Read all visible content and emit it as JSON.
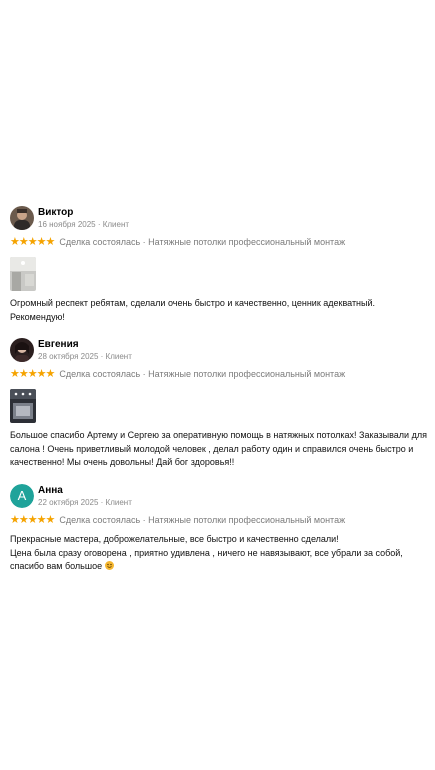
{
  "colors": {
    "star": "#f5a300",
    "meta_text": "#8a8a8a",
    "avatar_anna": "#1fa39a"
  },
  "reviews": [
    {
      "author": "Виктор",
      "meta": "16 ноября 2025 · Клиент",
      "rating": 5,
      "stars": [
        "★",
        "★",
        "★",
        "★",
        "★"
      ],
      "deal": "Сделка состоялась · Натяжные потолки профессиональный монтаж",
      "avatar_type": "photo",
      "has_photo": true,
      "text_lines": [
        "Огромный респект ребятам, сделали очень быстро и качественно, ценник адекватный.",
        "Рекомендую!"
      ]
    },
    {
      "author": "Евгения",
      "meta": "28 октября 2025 · Клиент",
      "rating": 5,
      "stars": [
        "★",
        "★",
        "★",
        "★",
        "★"
      ],
      "deal": "Сделка состоялась · Натяжные потолки профессиональный монтаж",
      "avatar_type": "photo",
      "has_photo": true,
      "text_lines": [
        "Большое спасибо Артему и Сергею за оперативную помощь в натяжных потолках! Заказывали для",
        "салона ! Очень приветливый молодой человек , делал работу один и справился очень быстро и",
        "качественно! Мы очень довольны! Дай бог здоровья!!"
      ]
    },
    {
      "author": "Анна",
      "meta": "22 октября 2025 · Клиент",
      "avatar_letter": "А",
      "rating": 5,
      "stars": [
        "★",
        "★",
        "★",
        "★",
        "★"
      ],
      "deal": "Сделка состоялась · Натяжные потолки профессиональный монтаж",
      "avatar_type": "letter",
      "has_photo": false,
      "text_lines": [
        "Прекрасные мастера, доброжелательные, все быстро и качественно сделали!",
        "Цена была сразу оговорена , приятно удивлена , ничего не навязывают, все убрали за собой,",
        "спасибо вам большое"
      ],
      "emoji_icon": "smiling-face-emoji"
    }
  ]
}
